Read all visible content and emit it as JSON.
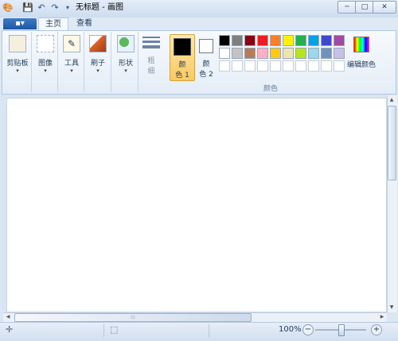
{
  "titlebar": {
    "title": "无标题 - 画图",
    "qa_icons": [
      "paint-app-icon",
      "save-icon",
      "undo-icon",
      "redo-icon",
      "customize-icon"
    ],
    "buttons": {
      "minimize": "─",
      "maximize": "□",
      "close": "✕"
    }
  },
  "tabs": {
    "file": "▪▾",
    "home": "主页",
    "view": "查看"
  },
  "ribbon": {
    "clipboard": "剪贴板",
    "image": "图像",
    "tools": "工具",
    "brushes": "刷子",
    "shapes": "形状",
    "size_line1": "粗",
    "size_line2": "细",
    "color1_line1": "颜",
    "color1_line2": "色 1",
    "color2_line1": "颜",
    "color2_line2": "色 2",
    "colors_group": "颜色",
    "edit_colors": "编辑颜色",
    "dropdown_arrow": "▾",
    "color1": "#000000",
    "color2": "#ffffff",
    "palette_row1": [
      "#000000",
      "#7f7f7f",
      "#880015",
      "#ed1c24",
      "#ff7f27",
      "#fff200",
      "#22b14c",
      "#00a2e8",
      "#3f48cc",
      "#a349a4"
    ],
    "palette_row2": [
      "#ffffff",
      "#c3c3c3",
      "#b97a57",
      "#ffaec9",
      "#ffc90e",
      "#efe4b0",
      "#b5e61d",
      "#99d9ea",
      "#7092be",
      "#c8bfe7"
    ]
  },
  "status": {
    "zoom": "100%",
    "minus": "−",
    "plus": "+",
    "move_icon": "✛",
    "select_icon": "⬚"
  },
  "scroll": {
    "up": "▲",
    "down": "▼",
    "left": "◀",
    "right": "▶",
    "grip": "⁝⁝⁝"
  }
}
